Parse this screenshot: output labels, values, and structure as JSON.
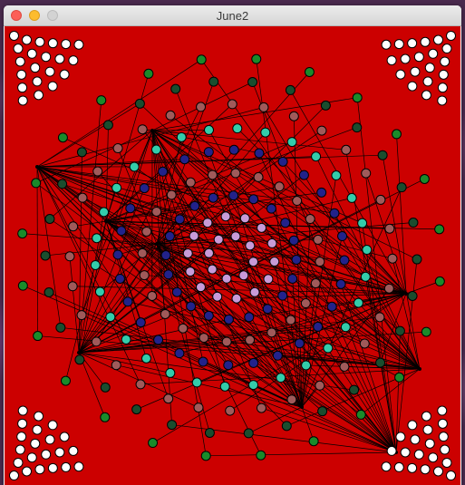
{
  "window": {
    "title": "June2"
  },
  "colors": {
    "canvas_bg": "#cc0000",
    "line": "#000000",
    "white_dot": "#ffffff",
    "dark_green": "#1a4d2e",
    "green": "#1a8a2a",
    "mauve": "#a05a5a",
    "teal": "#33ccaa",
    "navy": "#22228a",
    "lavender": "#c89ad8"
  },
  "icons": [
    "close-icon",
    "minimize-icon",
    "zoom-icon"
  ]
}
